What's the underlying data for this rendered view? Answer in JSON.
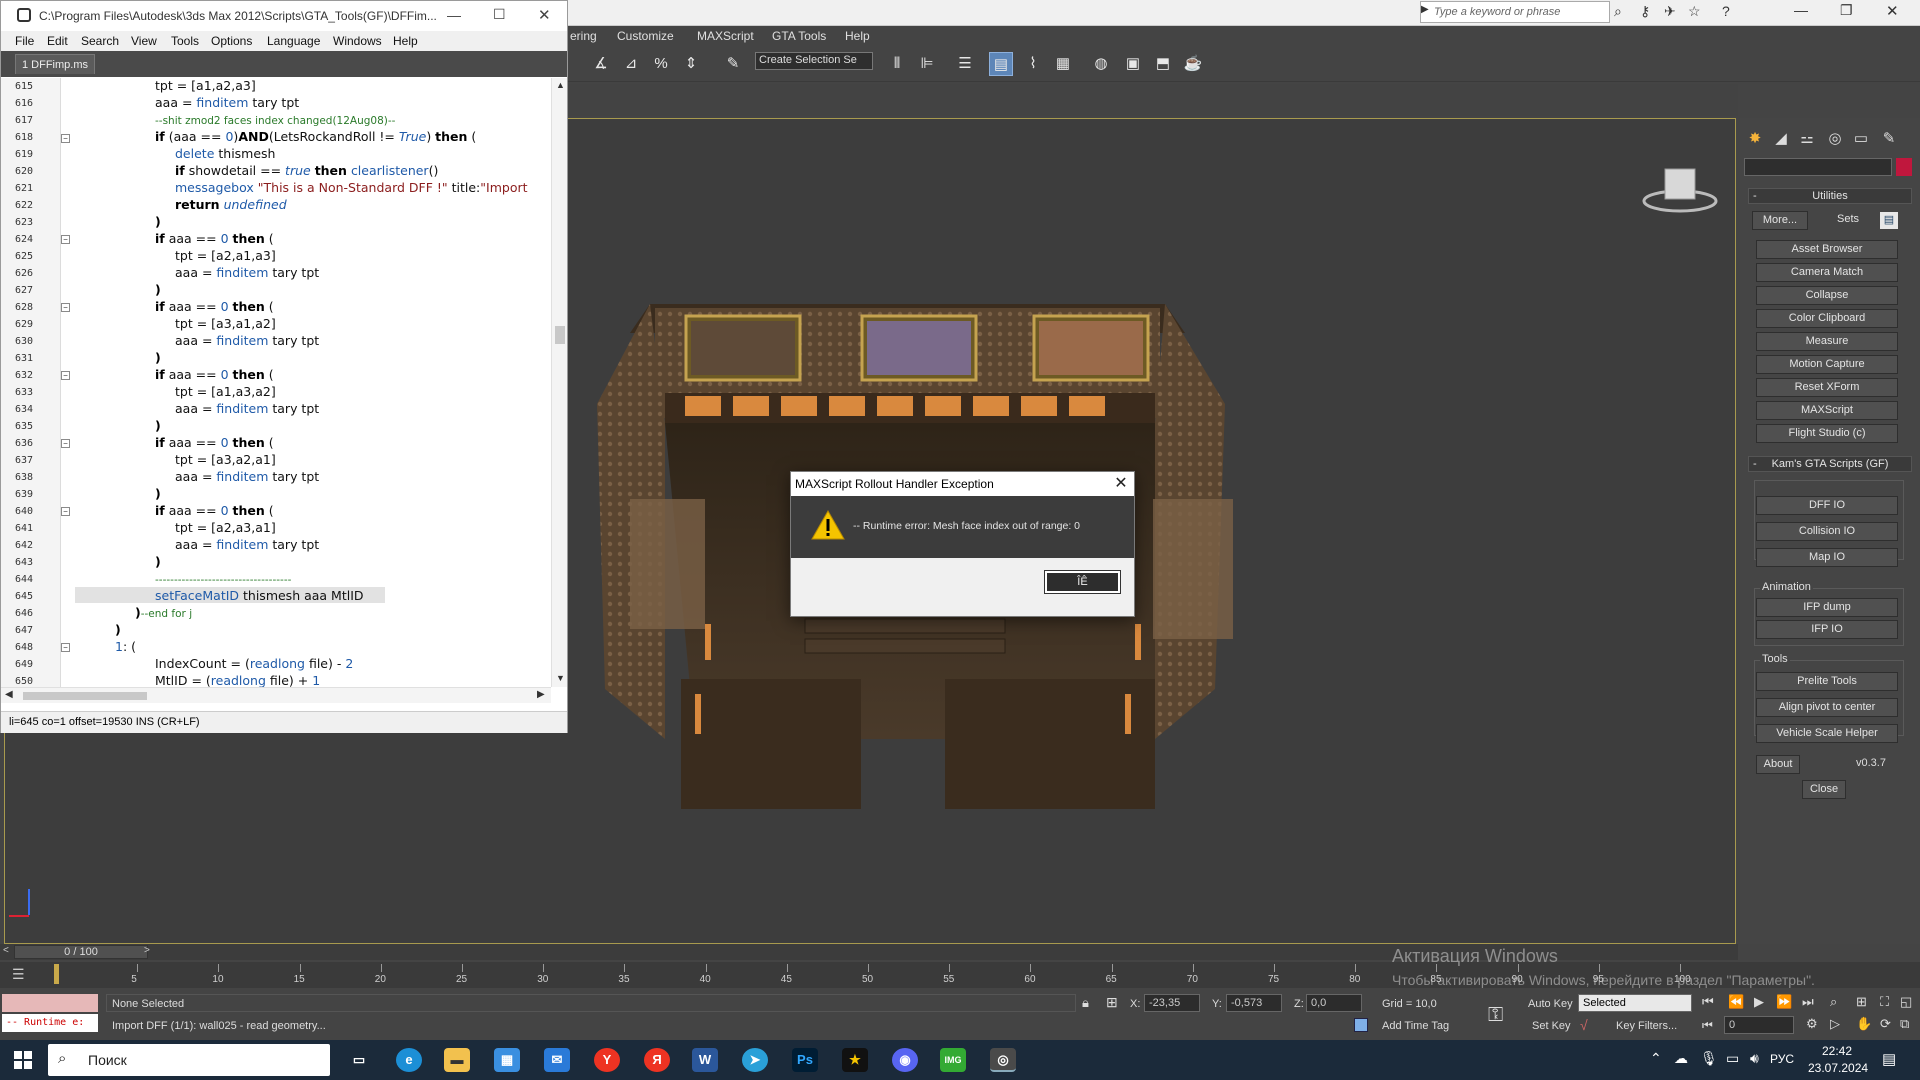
{
  "max": {
    "menu": [
      "ering",
      "Customize",
      "MAXScript",
      "GTA Tools",
      "Help"
    ],
    "search_placeholder": "Type a keyword or phrase",
    "selection_set_placeholder": "Create Selection Se"
  },
  "editor": {
    "title": "C:\\Program Files\\Autodesk\\3ds Max 2012\\Scripts\\GTA_Tools(GF)\\DFFim...",
    "menu": [
      "File",
      "Edit",
      "Search",
      "View",
      "Tools",
      "Options",
      "Language",
      "Windows",
      "Help"
    ],
    "tab": "1 DFFimp.ms",
    "line_numbers": [
      "615",
      "616",
      "617",
      "618",
      "619",
      "620",
      "621",
      "622",
      "623",
      "624",
      "625",
      "626",
      "627",
      "628",
      "629",
      "630",
      "631",
      "632",
      "633",
      "634",
      "635",
      "636",
      "637",
      "638",
      "639",
      "640",
      "641",
      "642",
      "643",
      "644",
      "645",
      "646",
      "647",
      "648",
      "649",
      "650"
    ],
    "status": "li=645 co=1 offset=19530 INS (CR+LF)"
  },
  "dialog": {
    "title": "MAXScript Rollout Handler Exception",
    "message": "-- Runtime error: Mesh face index out of range: 0",
    "ok": "ÎÊ"
  },
  "command_panel": {
    "utilities_header": "Utilities",
    "more": "More...",
    "sets": "Sets",
    "utilities": [
      "Asset Browser",
      "Camera Match",
      "Collapse",
      "Color Clipboard",
      "Measure",
      "Motion Capture",
      "Reset XForm",
      "MAXScript",
      "Flight Studio (c)"
    ],
    "gta_header": "Kam's GTA Scripts (GF)",
    "io_buttons": [
      "DFF IO",
      "Collision IO",
      "Map IO"
    ],
    "animation_label": "Animation",
    "animation_buttons": [
      "IFP dump",
      "IFP IO"
    ],
    "tools_label": "Tools",
    "tools_buttons": [
      "Prelite Tools",
      "Align pivot to center",
      "Vehicle Scale Helper"
    ],
    "about": "About",
    "version": "v0.3.7",
    "close": "Close"
  },
  "timeline": {
    "frame_counter": "0 / 100",
    "ticks": [
      "5",
      "10",
      "15",
      "20",
      "25",
      "30",
      "35",
      "40",
      "45",
      "50",
      "55",
      "60",
      "65",
      "70",
      "75",
      "80",
      "85",
      "90",
      "95",
      "100"
    ]
  },
  "statusbar": {
    "listener_text": "-- Runtime e:",
    "selection": "None Selected",
    "prompt": "Import DFF (1/1): wall025 - read geometry...",
    "x_label": "X:",
    "x": "-23,35",
    "y_label": "Y:",
    "y": "-0,573",
    "z_label": "Z:",
    "z": "0,0",
    "grid": "Grid = 10,0",
    "add_time_tag": "Add Time Tag",
    "auto_key": "Auto Key",
    "set_key": "Set Key",
    "selected": "Selected",
    "key_filters": "Key Filters...",
    "frame": "0"
  },
  "watermark": {
    "line1": "Активация Windows",
    "line2": "Чтобы активировать Windows, перейдите в раздел \"Параметры\"."
  },
  "taskbar": {
    "search": "Поиск",
    "lang": "РУС",
    "time": "22:42",
    "date": "23.07.2024"
  },
  "colors": {
    "viewport_border": "#a89a4e",
    "active_tool": "#5d86b8",
    "keyword_blue": "#1f5aa8",
    "comment_green": "#2a7a2a"
  }
}
